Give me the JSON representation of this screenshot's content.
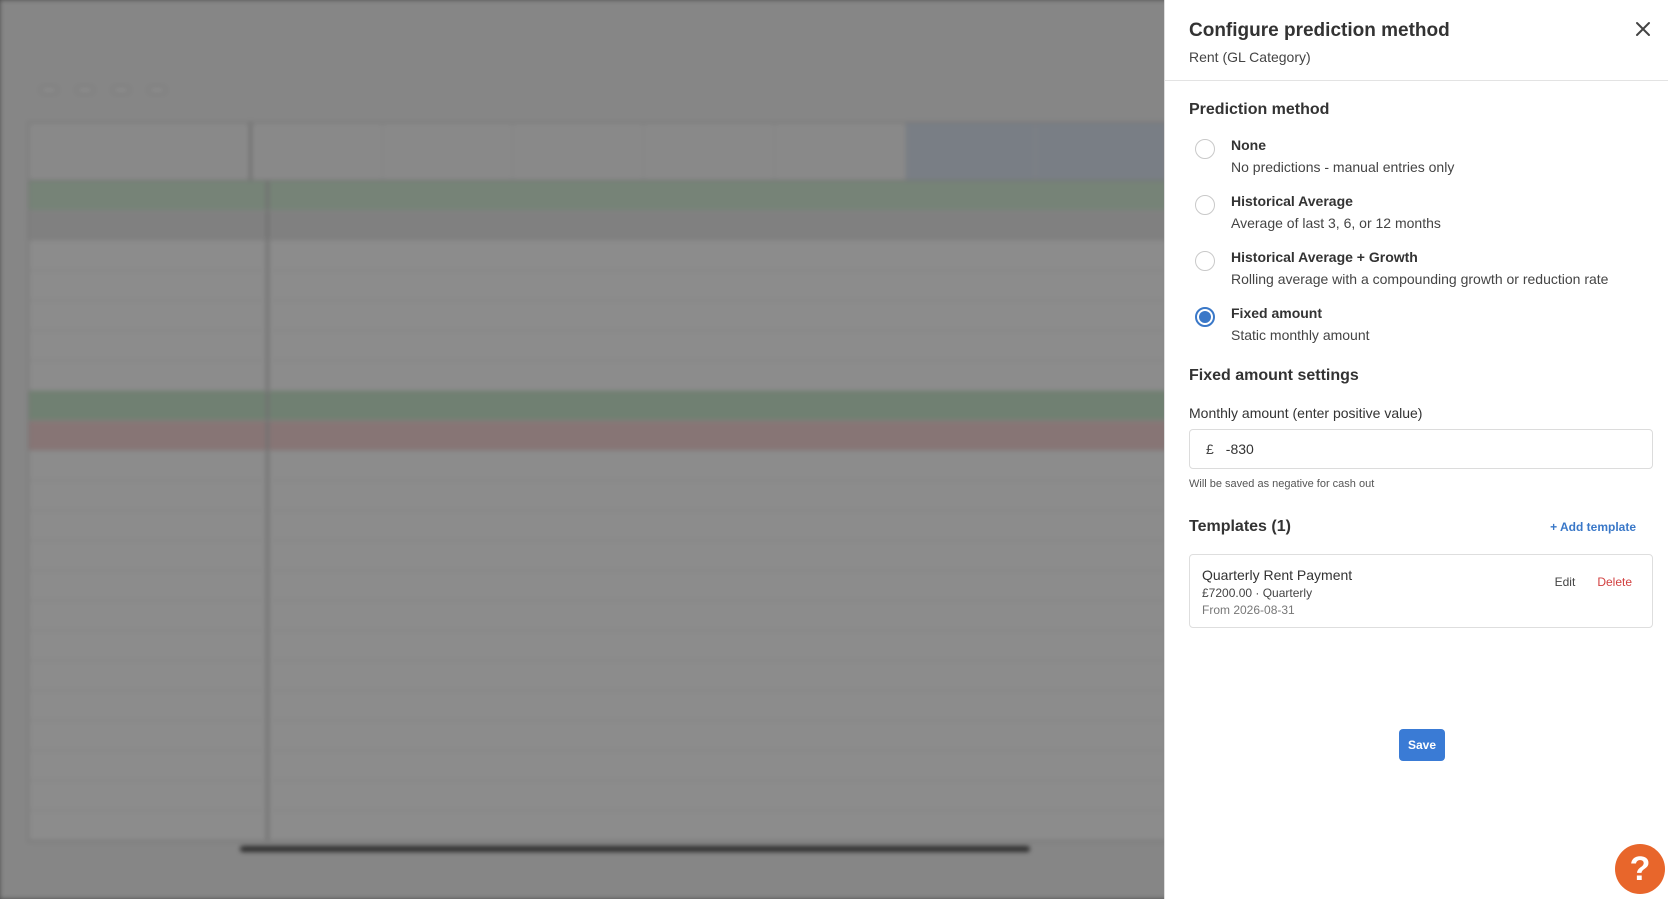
{
  "drawer": {
    "title": "Configure prediction method",
    "subtitle": "Rent (GL Category)",
    "prediction_section_title": "Prediction method",
    "options": [
      {
        "label": "None",
        "description": "No predictions - manual entries only",
        "checked": false
      },
      {
        "label": "Historical Average",
        "description": "Average of last 3, 6, or 12 months",
        "checked": false
      },
      {
        "label": "Historical Average + Growth",
        "description": "Rolling average with a compounding growth or reduction rate",
        "checked": false
      },
      {
        "label": "Fixed amount",
        "description": "Static monthly amount",
        "checked": true
      }
    ],
    "fixed_section_title": "Fixed amount settings",
    "amount_label": "Monthly amount (enter positive value)",
    "currency_symbol": "£",
    "amount_value": "-830",
    "amount_hint": "Will be saved as negative for cash out",
    "templates_title": "Templates (1)",
    "add_template_label": "+ Add template",
    "templates": [
      {
        "name": "Quarterly Rent Payment",
        "meta": "£7200.00 · Quarterly",
        "from": "From 2026-08-31",
        "edit_label": "Edit",
        "delete_label": "Delete"
      }
    ],
    "save_label": "Save"
  },
  "help": {
    "icon": "question-icon",
    "glyph": "?"
  },
  "colors": {
    "accent": "#3a78c8",
    "delete": "#d24040",
    "help": "#e8662b"
  }
}
